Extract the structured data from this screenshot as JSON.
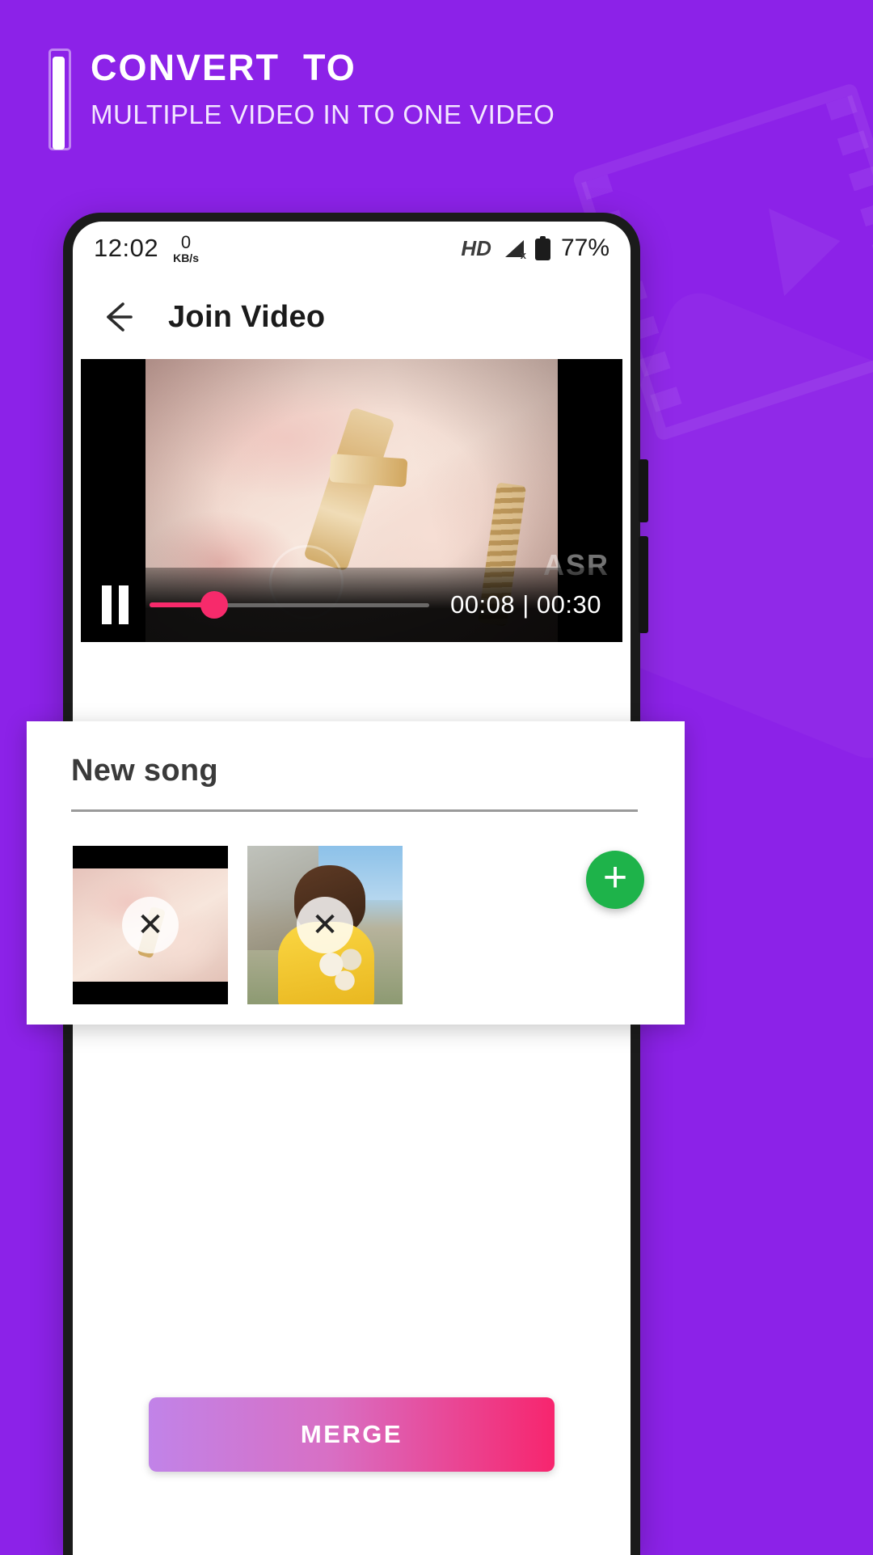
{
  "theme": {
    "background": "#8c22e8",
    "accent_pink": "#f72a6b",
    "accent_green": "#1eb34a"
  },
  "promo": {
    "title": "CONVERT  TO",
    "subtitle": "MULTIPLE VIDEO IN TO ONE VIDEO"
  },
  "status_bar": {
    "time": "12:02",
    "net_speed_value": "0",
    "net_speed_unit": "KB/s",
    "hd_label": "HD",
    "signal_icon": "signal-bars-icon",
    "signal_badge": "x",
    "battery_icon": "battery-icon",
    "battery_percent": "77%"
  },
  "app_bar": {
    "back_icon": "back-arrow-icon",
    "title": "Join Video"
  },
  "player": {
    "pause_icon": "pause-icon",
    "progress_percent": 23,
    "time_display": "00:08 | 00:30",
    "current_time": "00:08",
    "total_time": "00:30",
    "watermark": "ASR"
  },
  "sheet": {
    "title": "New song",
    "add_icon": "plus-icon",
    "clips": [
      {
        "label": "clip-1",
        "remove_icon": "close-icon",
        "remove_glyph": "✕"
      },
      {
        "label": "clip-2",
        "remove_icon": "close-icon",
        "remove_glyph": "✕"
      }
    ]
  },
  "actions": {
    "merge_label": "MERGE"
  }
}
